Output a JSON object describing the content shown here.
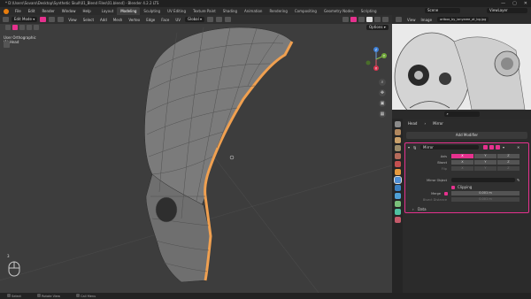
{
  "window": {
    "path": "* D:\\Users\\Sovaro\\Desktop\\Synthetic Skull\\01_Blend Files\\01.blend] - Blender 4.2.2 LTS",
    "controls": [
      "—",
      "▢",
      "✕"
    ]
  },
  "menubar": {
    "items": [
      "File",
      "Edit",
      "Render",
      "Window",
      "Help"
    ],
    "workspaces": [
      "Layout",
      "Modeling",
      "Sculpting",
      "UV Editing",
      "Texture Paint",
      "Shading",
      "Animation",
      "Rendering",
      "Compositing",
      "Geometry Nodes",
      "Scripting"
    ],
    "active_workspace": "Modeling",
    "scene": "Scene",
    "view_layer": "ViewLayer"
  },
  "viewport": {
    "mode": "Edit Mode",
    "menus": [
      "View",
      "Select",
      "Add",
      "Mesh",
      "Vertex",
      "Edge",
      "Face",
      "UV"
    ],
    "orientation": "Global",
    "options": "Options",
    "info_line1": "User Orthographic",
    "info_line2": "(1) Head",
    "gizmo_axes": [
      "Z",
      "Y",
      "X"
    ],
    "mouse_hint_number": "3"
  },
  "reference": {
    "menus": [
      "View",
      "Image"
    ],
    "image_name": "artbox_by_ianyaree_at_bg.jpg"
  },
  "properties": {
    "search_placeholder": "",
    "breadcrumb_object": "Head",
    "breadcrumb_modifier": "Mirror",
    "add_modifier": "Add Modifier",
    "modifier_name": "Mirror",
    "axis_label": "Axis",
    "bisect_label": "Bisect",
    "flip_label": "Flip",
    "axes": [
      "X",
      "Y",
      "Z"
    ],
    "axis_on": [
      true,
      false,
      false
    ],
    "mirror_object_label": "Mirror Object",
    "mirror_object_placeholder": "",
    "clipping_label": "Clipping",
    "merge_label": "Merge",
    "merge_value": "0.001 m",
    "bisect_distance_label": "Bisect Distance",
    "bisect_distance_value": "0.001 m",
    "data_label": "Data"
  },
  "statusbar": {
    "items": [
      "Select",
      "Rotate View",
      "Call Menu"
    ]
  },
  "colors": {
    "accent": "#e6318e",
    "mesh_edge": "#f0a050"
  }
}
